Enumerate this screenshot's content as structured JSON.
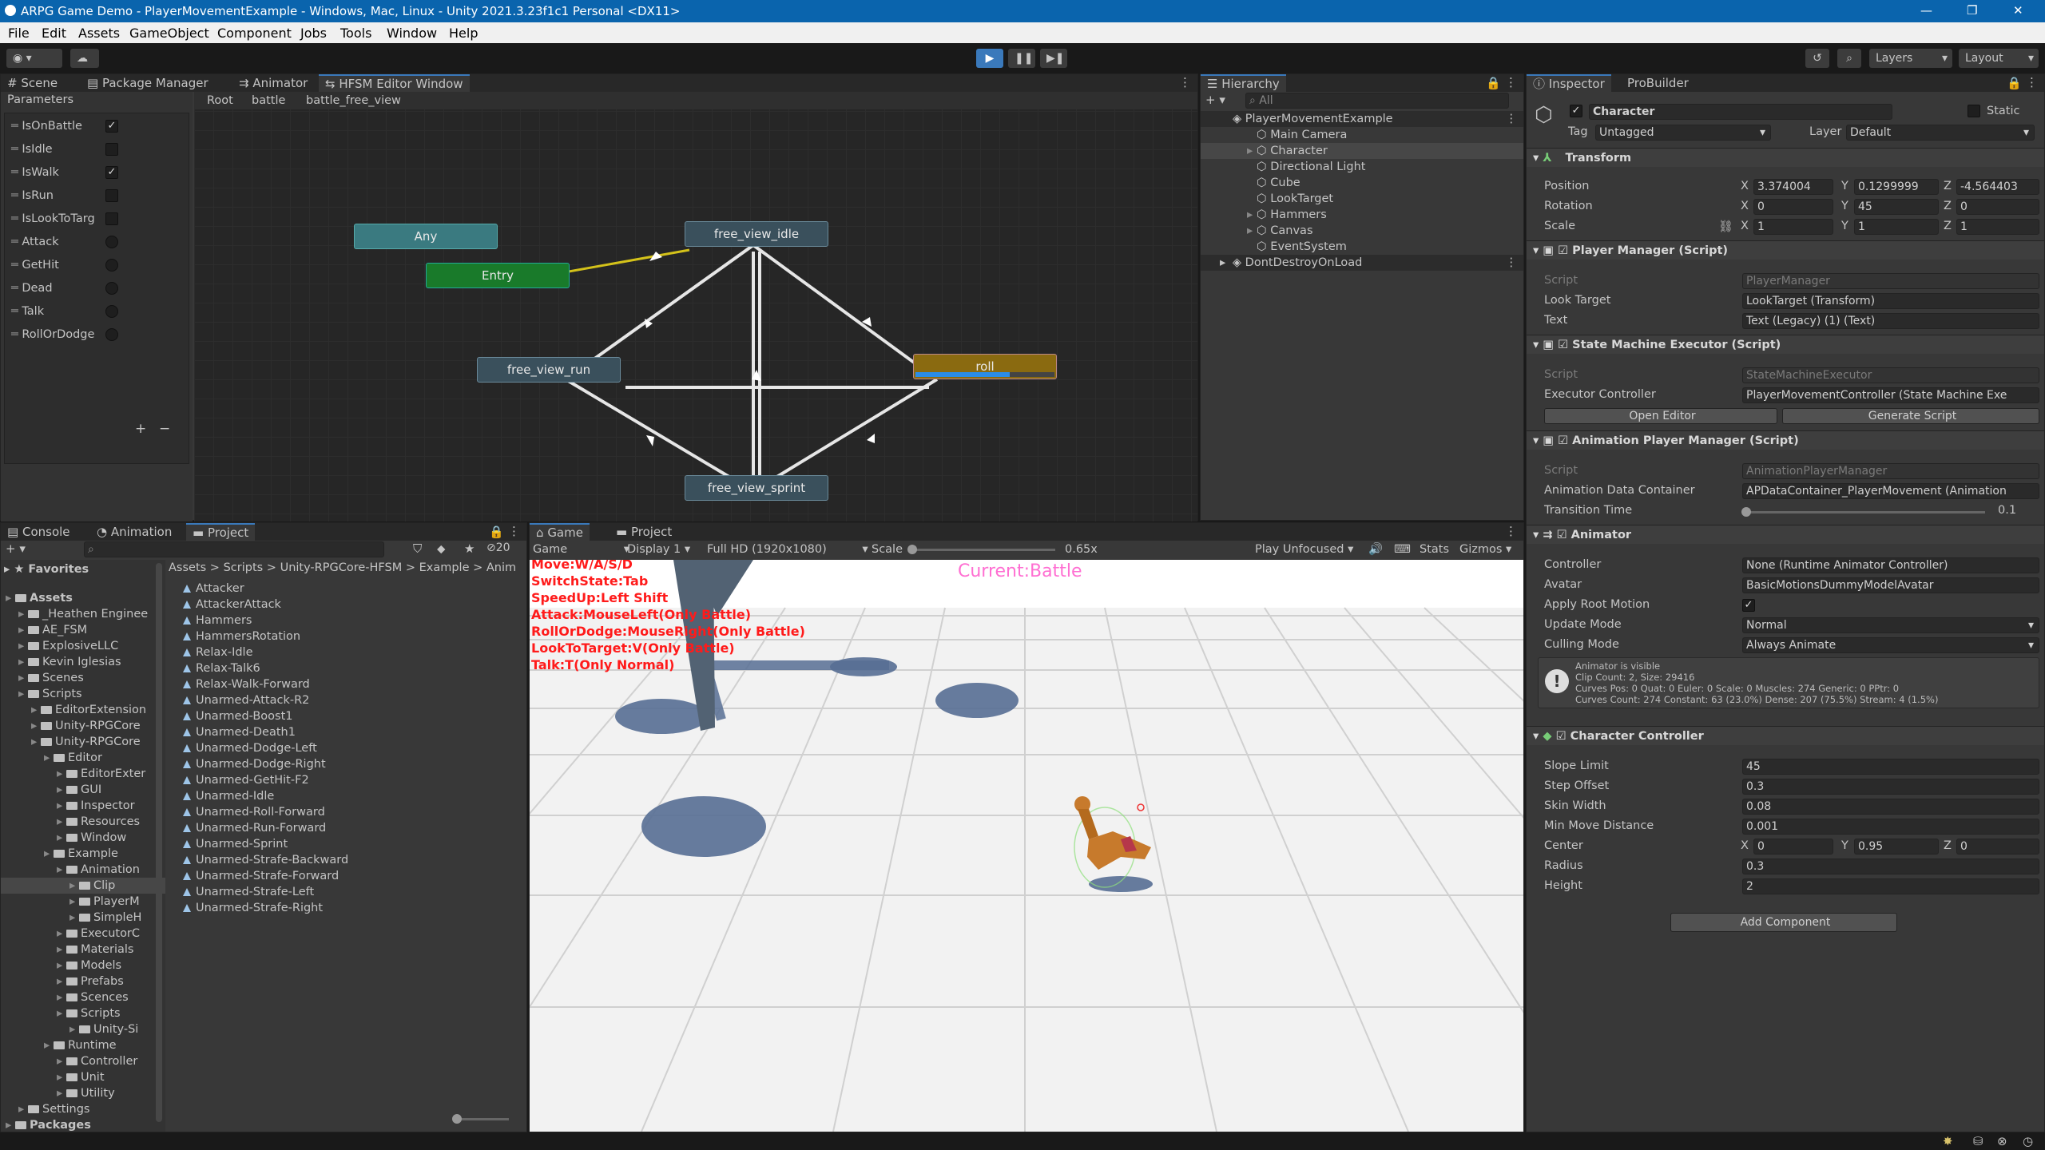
{
  "window": {
    "title": "ARPG Game Demo - PlayerMovementExample - Windows, Mac, Linux - Unity 2021.3.23f1c1 Personal <DX11>"
  },
  "menu": [
    "File",
    "Edit",
    "Assets",
    "GameObject",
    "Component",
    "Jobs",
    "Tools",
    "Window",
    "Help"
  ],
  "toolbar": {
    "layers": "Layers",
    "layout": "Layout"
  },
  "topleft": {
    "tabs": [
      "Scene",
      "Package Manager",
      "Animator",
      "HFSM Editor Window"
    ],
    "params_label": "Parameters",
    "breadcrumb": [
      "Root",
      "battle",
      "battle_free_view"
    ],
    "params": [
      {
        "name": "IsOnBattle",
        "kind": "check",
        "on": true
      },
      {
        "name": "IsIdle",
        "kind": "check",
        "on": false
      },
      {
        "name": "IsWalk",
        "kind": "check",
        "on": true
      },
      {
        "name": "IsRun",
        "kind": "check",
        "on": false
      },
      {
        "name": "IsLookToTarg",
        "kind": "check",
        "on": false
      },
      {
        "name": "Attack",
        "kind": "trigger"
      },
      {
        "name": "GetHit",
        "kind": "trigger"
      },
      {
        "name": "Dead",
        "kind": "trigger"
      },
      {
        "name": "Talk",
        "kind": "trigger"
      },
      {
        "name": "RollOrDodge",
        "kind": "trigger"
      }
    ],
    "nodes": {
      "any": "Any",
      "entry": "Entry",
      "idle": "free_view_idle",
      "run": "free_view_run",
      "roll": "roll",
      "sprint": "free_view_sprint"
    },
    "roll_progress": 0.68
  },
  "hierarchy": {
    "tab": "Hierarchy",
    "search_placeholder": "All",
    "scene": "PlayerMovementExample",
    "items": [
      "Main Camera",
      "Character",
      "Directional Light",
      "Cube",
      "LookTarget",
      "Hammers",
      "Canvas",
      "EventSystem"
    ],
    "dontdestroy": "DontDestroyOnLoad"
  },
  "inspector": {
    "tabs": [
      "Inspector",
      "ProBuilder"
    ],
    "object": "Character",
    "static": "Static",
    "tag_label": "Tag",
    "tag": "Untagged",
    "layer_label": "Layer",
    "layer": "Default",
    "transform": {
      "title": "Transform",
      "position": {
        "label": "Position",
        "x": "3.374004",
        "y": "0.1299999",
        "z": "-4.564403"
      },
      "rotation": {
        "label": "Rotation",
        "x": "0",
        "y": "45",
        "z": "0"
      },
      "scale": {
        "label": "Scale",
        "x": "1",
        "y": "1",
        "z": "1"
      }
    },
    "player_manager": {
      "title": "Player Manager (Script)",
      "script_label": "Script",
      "script": "PlayerManager",
      "look_label": "Look Target",
      "look": "LookTarget (Transform)",
      "text_label": "Text",
      "text": "Text (Legacy) (1) (Text)"
    },
    "sme": {
      "title": "State Machine Executor (Script)",
      "script_label": "Script",
      "script": "StateMachineExecutor",
      "ctrl_label": "Executor Controller",
      "ctrl": "PlayerMovementController (State Machine Exe",
      "open": "Open Editor",
      "gen": "Generate Script"
    },
    "apm": {
      "title": "Animation Player Manager (Script)",
      "script_label": "Script",
      "script": "AnimationPlayerManager",
      "adc_label": "Animation Data Container",
      "adc": "APDataContainer_PlayerMovement (Animation",
      "tt_label": "Transition Time",
      "tt": "0.1"
    },
    "animator": {
      "title": "Animator",
      "controller_label": "Controller",
      "controller": "None (Runtime Animator Controller)",
      "avatar_label": "Avatar",
      "avatar": "BasicMotionsDummyModelAvatar",
      "root_label": "Apply Root Motion",
      "update_label": "Update Mode",
      "update": "Normal",
      "cull_label": "Culling Mode",
      "cull": "Always Animate",
      "info": [
        "Animator is visible",
        "Clip Count: 2, Size: 29416",
        "Curves Pos: 0 Quat: 0 Euler: 0 Scale: 0 Muscles: 274 Generic: 0 PPtr: 0",
        "Curves Count: 274 Constant: 63 (23.0%) Dense: 207 (75.5%) Stream: 4 (1.5%)"
      ]
    },
    "cc": {
      "title": "Character Controller",
      "slope_label": "Slope Limit",
      "slope": "45",
      "step_label": "Step Offset",
      "step": "0.3",
      "skin_label": "Skin Width",
      "skin": "0.08",
      "minmove_label": "Min Move Distance",
      "minmove": "0.001",
      "center_label": "Center",
      "cx": "0",
      "cy": "0.95",
      "cz": "0",
      "radius_label": "Radius",
      "radius": "0.3",
      "height_label": "Height",
      "height": "2"
    },
    "add_component": "Add Component"
  },
  "bottomleft": {
    "tabs": [
      "Console",
      "Animation",
      "Project"
    ],
    "favorites": "Favorites",
    "count": "20",
    "breadcrumb": [
      "Assets",
      "Scripts",
      "Unity-RPGCore-HFSM",
      "Example",
      "Anim"
    ],
    "tree": [
      {
        "t": "Assets",
        "d": 0,
        "b": true
      },
      {
        "t": "_Heathen Enginee",
        "d": 1
      },
      {
        "t": "AE_FSM",
        "d": 1
      },
      {
        "t": "ExplosiveLLC",
        "d": 1
      },
      {
        "t": "Kevin Iglesias",
        "d": 1
      },
      {
        "t": "Scenes",
        "d": 1
      },
      {
        "t": "Scripts",
        "d": 1
      },
      {
        "t": "EditorExtension",
        "d": 2
      },
      {
        "t": "Unity-RPGCore",
        "d": 2
      },
      {
        "t": "Unity-RPGCore",
        "d": 2
      },
      {
        "t": "Editor",
        "d": 3
      },
      {
        "t": "EditorExter",
        "d": 4
      },
      {
        "t": "GUI",
        "d": 4
      },
      {
        "t": "Inspector",
        "d": 4
      },
      {
        "t": "Resources",
        "d": 4
      },
      {
        "t": "Window",
        "d": 4
      },
      {
        "t": "Example",
        "d": 3
      },
      {
        "t": "Animation",
        "d": 4
      },
      {
        "t": "Clip",
        "d": 5,
        "sel": true
      },
      {
        "t": "PlayerM",
        "d": 5
      },
      {
        "t": "SimpleH",
        "d": 5
      },
      {
        "t": "ExecutorC",
        "d": 4
      },
      {
        "t": "Materials",
        "d": 4
      },
      {
        "t": "Models",
        "d": 4
      },
      {
        "t": "Prefabs",
        "d": 4
      },
      {
        "t": "Scences",
        "d": 4
      },
      {
        "t": "Scripts",
        "d": 4
      },
      {
        "t": "Unity-Si",
        "d": 5
      },
      {
        "t": "Runtime",
        "d": 3
      },
      {
        "t": "Controller",
        "d": 4
      },
      {
        "t": "Unit",
        "d": 4
      },
      {
        "t": "Utility",
        "d": 4
      },
      {
        "t": "Settings",
        "d": 1
      },
      {
        "t": "Packages",
        "d": 0,
        "b": true
      }
    ],
    "files": [
      "Attacker",
      "AttackerAttack",
      "Hammers",
      "HammersRotation",
      "Relax-Idle",
      "Relax-Talk6",
      "Relax-Walk-Forward",
      "Unarmed-Attack-R2",
      "Unarmed-Boost1",
      "Unarmed-Death1",
      "Unarmed-Dodge-Left",
      "Unarmed-Dodge-Right",
      "Unarmed-GetHit-F2",
      "Unarmed-Idle",
      "Unarmed-Roll-Forward",
      "Unarmed-Run-Forward",
      "Unarmed-Sprint",
      "Unarmed-Strafe-Backward",
      "Unarmed-Strafe-Forward",
      "Unarmed-Strafe-Left",
      "Unarmed-Strafe-Right"
    ]
  },
  "game": {
    "tabs": [
      "Game",
      "Project"
    ],
    "view": "Game",
    "display": "Display 1",
    "res": "Full HD (1920x1080)",
    "scale_label": "Scale",
    "scale": "0.65x",
    "play": "Play Unfocused",
    "stats": "Stats",
    "gizmos": "Gizmos",
    "current": "Current:Battle",
    "help": [
      "Move:W/A/S/D",
      "SwitchState:Tab",
      "SpeedUp:Left Shift",
      "Attack:MouseLeft(Only Battle)",
      "RollOrDodge:MouseRight(Only Battle)",
      "LookToTarget:V(Only Battle)",
      "Talk:T(Only Normal)"
    ]
  }
}
